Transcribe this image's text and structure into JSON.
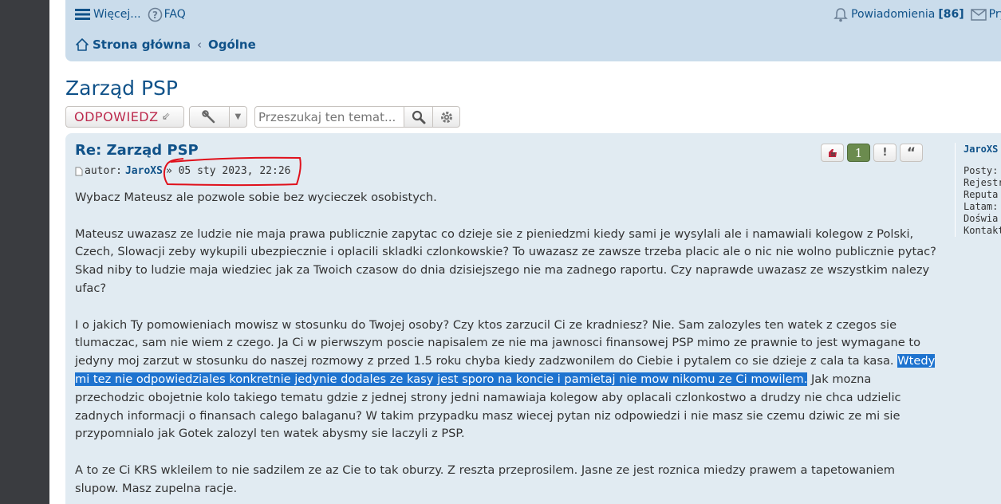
{
  "nav": {
    "more": "Więcej...",
    "faq": "FAQ",
    "notifications": "Powiadomienia",
    "notifications_count": "[86]",
    "private_messages": "Pry"
  },
  "breadcrumbs": {
    "home": "Strona główna",
    "sep": "‹",
    "forum": "Ogólne"
  },
  "topic": {
    "title": "Zarząd PSP"
  },
  "toolbar": {
    "reply_label": "ODPOWIEDZ",
    "reply_arrow": "⇙",
    "search_placeholder": "Przeszukaj ten temat..."
  },
  "post": {
    "title": "Re: Zarząd PSP",
    "author_prefix": "autor:",
    "author": "JaroXS",
    "date": "» 05 sty 2023, 22:26",
    "like_count": "1",
    "report_symbol": "!",
    "quote_symbol": "“",
    "paragraphs": [
      {
        "text": "Wybacz Mateusz ale pozwole sobie bez wycieczek osobistych."
      },
      {
        "text": "Mateusz uwazasz ze ludzie nie maja prawa publicznie zapytac co dzieje sie z pieniedzmi kiedy sami je wysylali ale i namawiali kolegow z Polski, Czech, Slowacji zeby wykupili ubezpiecznie i oplacili skladki czlonkowskie? To uwazasz ze zawsze trzeba placic ale o nic nie wolno publicznie pytac? Skad niby to ludzie maja wiedziec jak za Twoich czasow do dnia dzisiejszego nie ma zadnego raportu. Czy naprawde uwazasz ze wszystkim nalezy ufac?"
      },
      {
        "before": "I o jakich Ty pomowieniach mowisz w stosunku do Twojej osoby? Czy ktos zarzucil Ci ze kradniesz? Nie. Sam zalozyles ten watek z czegos sie tlumaczac, sam nie wiem z czego. Ja Ci w pierwszym poscie napisalem ze nie ma jawnosci finansowej PSP mimo ze prawnie to jest wymagane to jedyny moj zarzut w stosunku do naszej rozmowy z przed 1.5 roku chyba kiedy zadzwonilem do Ciebie i pytalem co sie dzieje z cala ta kasa. ",
        "selected": "Wtedy mi tez nie odpowiedziales konkretnie jedynie dodales ze kasy jest sporo na koncie i pamietaj nie mow nikomu ze Ci mowilem.",
        "after": " Jak mozna przechodzic obojetnie kolo takiego tematu gdzie z jednej strony jedni namawiaja kolegow aby oplacali czlonkostwo a drudzy nie chca udzielic zadnych informacji o finansach calego balaganu? W takim przypadku masz wiecej pytan niz odpowiedzi i nie masz sie czemu dziwic ze mi sie przypomnialo jak Gotek zalozyl ten watek abysmy sie laczyli z PSP."
      },
      {
        "text": "A to ze Ci KRS wkleilem to nie sadzilem ze az Cie to tak oburzy. Z reszta przeprosilem. Jasne ze jest roznica miedzy prawem a tapetowaniem slupow. Masz zupelna racje."
      }
    ]
  },
  "profile": {
    "username": "JaroXS",
    "fields": [
      "Posty:",
      "Rejestr",
      "Reputa",
      "Latam:",
      "Doświa",
      "Kontakt"
    ]
  },
  "colors": {
    "link": "#105289",
    "post_bg": "#e1ebf2",
    "nav_bg": "#cadceb",
    "reply": "#bc2a4d",
    "selection": "#1e73cf",
    "annotation": "#e0101b"
  }
}
